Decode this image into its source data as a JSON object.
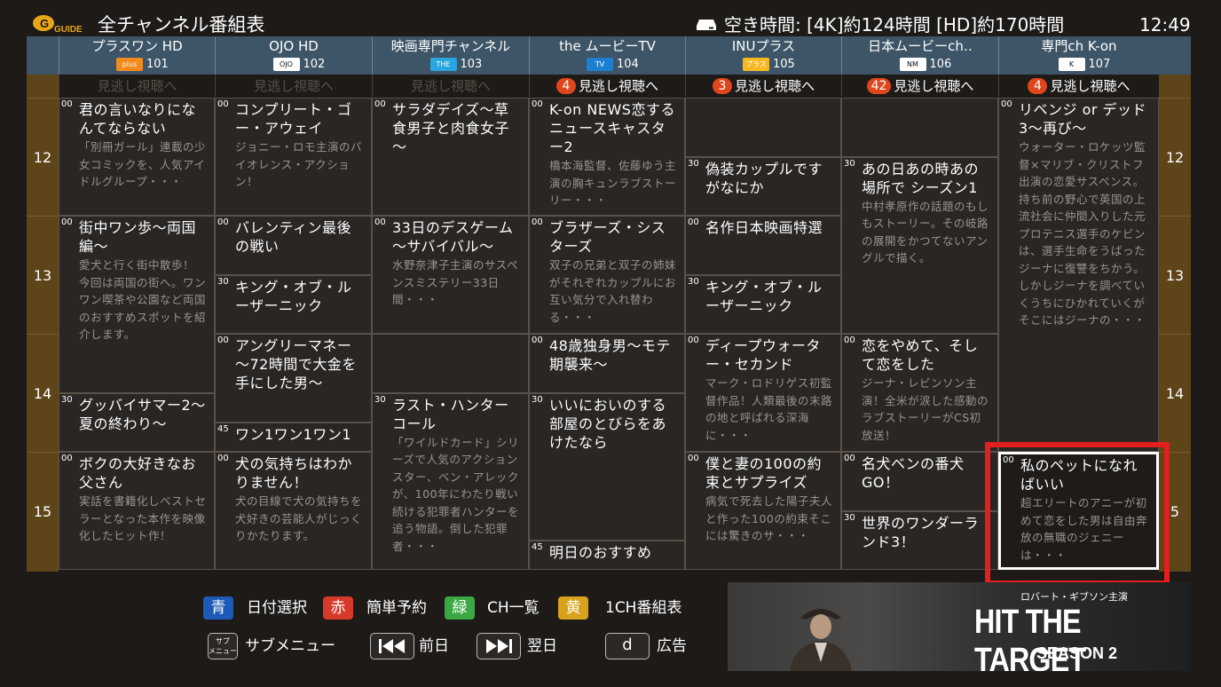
{
  "header": {
    "title": "全チャンネル番組表",
    "free_space": "空き時間: [4K]約124時間 [HD]約170時間",
    "clock": "12:49",
    "logo_text": "G GUIDE"
  },
  "hours": [
    "12",
    "13",
    "14",
    "15"
  ],
  "hours_right": [
    "12",
    "13",
    "14",
    "5"
  ],
  "channels": [
    {
      "name": "プラスワン HD",
      "number": "101",
      "logo": "plus one",
      "logo_color": "#f28a1e"
    },
    {
      "name": "OJO HD",
      "number": "102",
      "logo": "OJO",
      "logo_color": "#ffffff"
    },
    {
      "name": "映画専門チャンネル",
      "number": "103",
      "logo": "THE MOVIE",
      "logo_color": "#2aa6de"
    },
    {
      "name": "the ムービーTV",
      "number": "104",
      "logo": "TV",
      "logo_color": "#1e7fd0"
    },
    {
      "name": "INUプラス",
      "number": "105",
      "logo": "プラス",
      "logo_color": "#f5b920"
    },
    {
      "name": "日本ムービーch‥",
      "number": "106",
      "logo": "NM",
      "logo_color": "#ffffff"
    },
    {
      "name": "専門ch K-on",
      "number": "107",
      "logo": "K",
      "logo_color": "#ffffff"
    }
  ],
  "missed": [
    {
      "label": "見逃し視聴へ",
      "count": "",
      "state": "dim"
    },
    {
      "label": "見逃し視聴へ",
      "count": "",
      "state": "dim"
    },
    {
      "label": "見逃し視聴へ",
      "count": "",
      "state": "dim"
    },
    {
      "label": "見逃し視聴へ",
      "count": "4",
      "state": "active"
    },
    {
      "label": "見逃し視聴へ",
      "count": "3",
      "state": "active"
    },
    {
      "label": "見逃し視聴へ",
      "count": "42",
      "state": "active"
    },
    {
      "label": "見逃し視聴へ",
      "count": "4",
      "state": "active"
    }
  ],
  "programs": [
    [
      {
        "min": "00",
        "title": "君の言いなりになんてならない",
        "desc": "「別冊ガール」連載の少女コミックを、人気アイドルグループ・・・",
        "start": 0,
        "len": 60
      },
      {
        "min": "00",
        "title": "街中ワン歩～両国編～",
        "desc": "愛犬と行く街中散歩！\n今回は両国の街へ。ワンワン喫茶や公園など両国のおすすめスポットを紹介します。",
        "start": 60,
        "len": 90
      },
      {
        "min": "30",
        "title": "グッバイサマー2～夏の終わり～",
        "desc": "",
        "start": 150,
        "len": 30
      },
      {
        "min": "00",
        "title": "ボクの大好きなお父さん",
        "desc": "実話を書籍化しベストセラーとなった本作を映像化したヒット作！",
        "start": 180,
        "len": 60
      }
    ],
    [
      {
        "min": "00",
        "title": "コンプリート・ゴー・アウェイ",
        "desc": "ジョニー・ロモ主演のバイオレンス・アクション！",
        "start": 0,
        "len": 60
      },
      {
        "min": "00",
        "title": "バレンティン最後の戦い",
        "desc": "",
        "start": 60,
        "len": 30
      },
      {
        "min": "30",
        "title": "キング・オブ・ルーザーニック",
        "desc": "",
        "start": 90,
        "len": 30
      },
      {
        "min": "00",
        "title": "アングリーマネー～72時間で大金を手にした男～",
        "desc": "",
        "start": 120,
        "len": 45
      },
      {
        "min": "45",
        "title": "ワン1ワン1ワン1",
        "desc": "",
        "start": 165,
        "len": 15
      },
      {
        "min": "00",
        "title": "犬の気持ちはわかりません！",
        "desc": "犬の目線で犬の気持ちを犬好きの芸能人がじっくりかたります。",
        "start": 180,
        "len": 60
      }
    ],
    [
      {
        "min": "00",
        "title": "サラダデイズ～草食男子と肉食女子～",
        "desc": "",
        "start": 0,
        "len": 60
      },
      {
        "min": "00",
        "title": "33日のデスゲーム～サバイバル～",
        "desc": "水野奈津子主演のサスペンスミステリー33日間・・・",
        "start": 60,
        "len": 60
      },
      {
        "min": "",
        "title": "",
        "desc": "",
        "start": 120,
        "len": 30
      },
      {
        "min": "30",
        "title": "ラスト・ハンターコール",
        "desc": "「ワイルドカード」シリーズで人気のアクションスター、ベン・アレックが、100年にわたり戦い続ける犯罪者ハンターを追う物語。倒した犯罪者・・・",
        "start": 150,
        "len": 90
      }
    ],
    [
      {
        "min": "00",
        "title": "K-on NEWS恋するニュースキャスター2",
        "desc": "橋本海監督、佐藤ゆう主演の胸キュンラブストーリー・・・",
        "start": 0,
        "len": 60
      },
      {
        "min": "00",
        "title": "ブラザーズ・シスターズ",
        "desc": "双子の兄弟と双子の姉妹がそれぞれカップルにお互い気分で入れ替わる・・・",
        "start": 60,
        "len": 60
      },
      {
        "min": "00",
        "title": "48歳独身男～モテ期襲来～",
        "desc": "",
        "start": 120,
        "len": 30
      },
      {
        "min": "30",
        "title": "いいにおいのする部屋のとびらをあけたなら",
        "desc": "",
        "start": 150,
        "len": 75
      },
      {
        "min": "45",
        "title": "明日のおすすめ",
        "desc": "",
        "start": 225,
        "len": 15
      }
    ],
    [
      {
        "min": "",
        "title": "",
        "desc": "",
        "start": 0,
        "len": 30
      },
      {
        "min": "30",
        "title": "偽装カップルですがなにか",
        "desc": "",
        "start": 30,
        "len": 30
      },
      {
        "min": "00",
        "title": "名作日本映画特選",
        "desc": "",
        "start": 60,
        "len": 30
      },
      {
        "min": "30",
        "title": "キング・オブ・ルーザーニック",
        "desc": "",
        "start": 90,
        "len": 30
      },
      {
        "min": "00",
        "title": "ディープウォーター・セカンド",
        "desc": "マーク・ロドリゲス初監督作品！人類最後の末路の地と呼ばれる深海に・・・",
        "start": 120,
        "len": 60
      },
      {
        "min": "00",
        "title": "僕と妻の100の約束とサプライズ",
        "desc": "病気で死去した陽子夫人と作った100の約束そこには驚きのサ・・・",
        "start": 180,
        "len": 60
      }
    ],
    [
      {
        "min": "",
        "title": "",
        "desc": "",
        "start": 0,
        "len": 30
      },
      {
        "min": "30",
        "title": "あの日あの時あの場所で シーズン1",
        "desc": "中村孝原作の話題のもしもストーリー。その岐路の展開をかつてないアングルで描く。",
        "start": 30,
        "len": 90
      },
      {
        "min": "00",
        "title": "恋をやめて、そして恋をした",
        "desc": "ジーナ・レビンソン主演！全米が涙した感動のラブストーリーがCS初放送！",
        "start": 120,
        "len": 60
      },
      {
        "min": "00",
        "title": "名犬ベンの番犬GO！",
        "desc": "",
        "start": 180,
        "len": 30
      },
      {
        "min": "30",
        "title": "世界のワンダーランド3！",
        "desc": "",
        "start": 210,
        "len": 30
      }
    ],
    [
      {
        "min": "00",
        "title": "リベンジ or デッド3～再び～",
        "desc": "ウォーター・ロケッツ監督×マリブ・クリストフ出演の恋愛サスペンス。持ち前の野心で英国の上流社会に仲間入りした元プロテニス選手のケビンは、選手生命をうばったジーナに復讐をちかう。しかしジーナを調べていくうちにひかれていくがそこにはジーナの・・・",
        "start": 0,
        "len": 180
      },
      {
        "min": "00",
        "title": "私のペットになればいい",
        "desc": "超エリートのアニーが初めて恋をした男は自由奔放の無職のジェニーは・・・",
        "start": 180,
        "len": 60,
        "selected": true
      }
    ]
  ],
  "keys": [
    {
      "label": "青",
      "text": "日付選択",
      "color": "#1e5bb8"
    },
    {
      "label": "赤",
      "text": "簡単予約",
      "color": "#d63a2a"
    },
    {
      "label": "緑",
      "text": "CH一覧",
      "color": "#3aa845"
    },
    {
      "label": "黄",
      "text": "1CH番組表",
      "color": "#d8a21c"
    }
  ],
  "buttons": {
    "sub_icon": "サブメニュー",
    "sub": "サブメニュー",
    "prev": "前日",
    "next": "翌日",
    "d_key": "d",
    "ad": "広告"
  },
  "banner": {
    "sub": "ロバート・ギブソン主演",
    "title": "HIT THE TARGET",
    "season": "SEASON 2"
  }
}
